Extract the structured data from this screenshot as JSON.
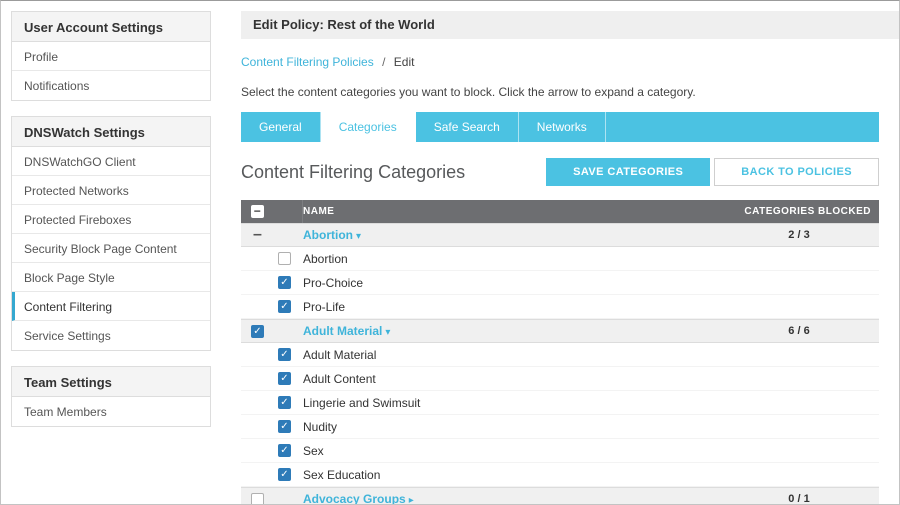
{
  "colors": {
    "accent_teal": "#4bc2e2",
    "link_teal": "#3fb4da",
    "checkbox_blue": "#2e7bb8",
    "table_header_bg": "#6d6e71"
  },
  "sidebar": {
    "sections": [
      {
        "title": "User Account Settings",
        "items": [
          {
            "label": "Profile"
          },
          {
            "label": "Notifications"
          }
        ]
      },
      {
        "title": "DNSWatch Settings",
        "items": [
          {
            "label": "DNSWatchGO Client"
          },
          {
            "label": "Protected Networks"
          },
          {
            "label": "Protected Fireboxes"
          },
          {
            "label": "Security Block Page Content"
          },
          {
            "label": "Block Page Style"
          },
          {
            "label": "Content Filtering",
            "active": true
          },
          {
            "label": "Service Settings"
          }
        ]
      },
      {
        "title": "Team Settings",
        "items": [
          {
            "label": "Team Members"
          }
        ]
      }
    ]
  },
  "header": {
    "title": "Edit Policy: Rest of the World"
  },
  "breadcrumb": {
    "link": "Content Filtering Policies",
    "separator": "/",
    "current": "Edit"
  },
  "instructions": "Select the content categories you want to block. Click the arrow to expand a category.",
  "tabs": [
    {
      "label": "General"
    },
    {
      "label": "Categories",
      "active": true
    },
    {
      "label": "Safe Search"
    },
    {
      "label": "Networks"
    }
  ],
  "section": {
    "title": "Content Filtering Categories",
    "save_button": "SAVE CATEGORIES",
    "back_button": "BACK TO POLICIES"
  },
  "table": {
    "select_all_glyph": "−",
    "check_glyph": "✓",
    "indeterminate_glyph": "–",
    "headers": {
      "name": "NAME",
      "blocked": "CATEGORIES BLOCKED"
    },
    "rows": [
      {
        "type": "category",
        "label": "Abortion",
        "checkbox": "indeterminate",
        "arrow": "down",
        "blocked": "2 / 3"
      },
      {
        "type": "sub",
        "label": "Abortion",
        "checkbox": "unchecked"
      },
      {
        "type": "sub",
        "label": "Pro-Choice",
        "checkbox": "checked"
      },
      {
        "type": "sub",
        "label": "Pro-Life",
        "checkbox": "checked"
      },
      {
        "type": "category",
        "label": "Adult Material",
        "checkbox": "checked",
        "arrow": "down",
        "blocked": "6 / 6"
      },
      {
        "type": "sub",
        "label": "Adult Material",
        "checkbox": "checked"
      },
      {
        "type": "sub",
        "label": "Adult Content",
        "checkbox": "checked"
      },
      {
        "type": "sub",
        "label": "Lingerie and Swimsuit",
        "checkbox": "checked"
      },
      {
        "type": "sub",
        "label": "Nudity",
        "checkbox": "checked"
      },
      {
        "type": "sub",
        "label": "Sex",
        "checkbox": "checked"
      },
      {
        "type": "sub",
        "label": "Sex Education",
        "checkbox": "checked"
      },
      {
        "type": "category",
        "label": "Advocacy Groups",
        "checkbox": "unchecked",
        "arrow": "right",
        "blocked": "0 / 1"
      }
    ]
  }
}
